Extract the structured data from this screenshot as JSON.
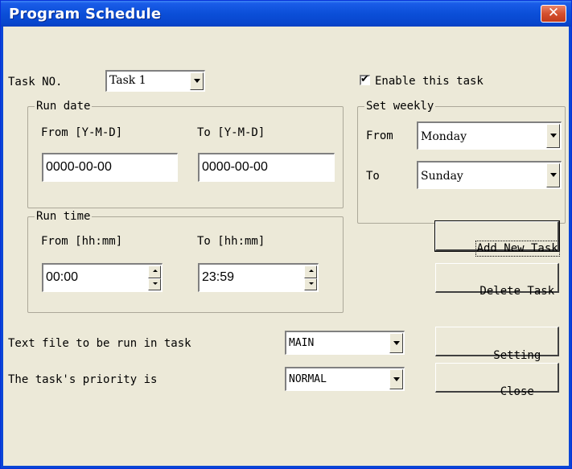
{
  "window": {
    "title": "Program Schedule",
    "close_icon": "close-x-icon"
  },
  "task": {
    "label": "Task NO.",
    "selected": "Task 1",
    "enable_label": "Enable this task",
    "enabled": true
  },
  "run_date": {
    "group_label": "Run date",
    "from_label": "From [Y-M-D]",
    "to_label": "To [Y-M-D]",
    "from_value": "0000-00-00",
    "to_value": "0000-00-00"
  },
  "set_weekly": {
    "group_label": "Set weekly",
    "from_label": "From",
    "to_label": "To",
    "from_value": "Monday",
    "to_value": "Sunday"
  },
  "run_time": {
    "group_label": "Run time",
    "from_label": "From [hh:mm]",
    "to_label": "To [hh:mm]",
    "from_value": "00:00",
    "to_value": "23:59"
  },
  "buttons": {
    "add": "Add New Task",
    "delete": "Delete Task",
    "setting": "Setting",
    "close": "Close"
  },
  "text_file": {
    "label": "Text file to be run in task",
    "value": "MAIN"
  },
  "priority": {
    "label": "The task's priority is",
    "value": "NORMAL"
  },
  "colors": {
    "title_bar": "#0a45d6",
    "dialog_background": "#ece9d8",
    "close_button": "#d4502e"
  }
}
